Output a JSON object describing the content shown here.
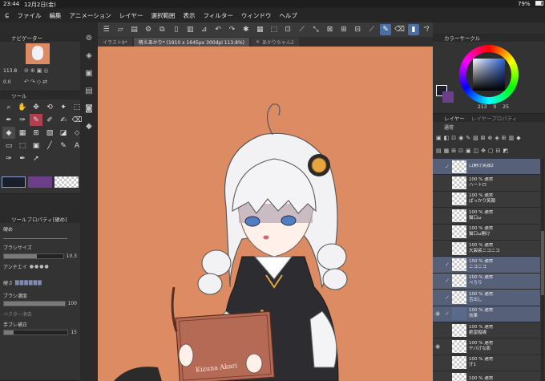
{
  "status": {
    "time": "23:44",
    "date": "12月2日(金)",
    "battery": "79%"
  },
  "menu": [
    "ファイル",
    "編集",
    "アニメーション",
    "レイヤー",
    "選択範囲",
    "表示",
    "フィルター",
    "ウィンドウ",
    "ヘルプ"
  ],
  "tabs": [
    {
      "label": "イラスト8*"
    },
    {
      "label": "萌えあかり* (1910 x 1645px 300dpi 113.8%)"
    },
    {
      "label": "あかりちゃん2"
    }
  ],
  "navigator": {
    "title": "ナビゲーター",
    "zoom": "113.8",
    "angle": "0.0"
  },
  "tool_panel": {
    "title": "ツール"
  },
  "tool_property": {
    "title": "ツールプロパティ[硬め]",
    "brush_name": "硬め",
    "brush_size_label": "ブラシサイズ",
    "brush_size_value": "10.3",
    "antialias_label": "アンチエイ",
    "hardness_label": "硬さ",
    "density_label": "ブラシ濃度",
    "density_value": "100",
    "vector_label": "ベクター消去",
    "stabilization_label": "手ブレ補正",
    "stabilization_value": "15"
  },
  "color": {
    "title": "カラーサークル",
    "readout": [
      "213",
      "0",
      "25"
    ],
    "main_color": "#1b1e2b",
    "sub_color": "#6b3f8a",
    "hue_indicator": "#2a5fd6"
  },
  "layer_panel": {
    "title": "レイヤー",
    "tab2": "レイヤープロパティ",
    "blend_mode": "通常",
    "layers": [
      {
        "line1": "口開け笑顔2",
        "line2": "",
        "selected": true,
        "checked": true,
        "eye": false,
        "folder": false
      },
      {
        "line1": "100 % 通常",
        "line2": "ハートロ",
        "selected": false,
        "checked": false,
        "eye": false,
        "folder": false
      },
      {
        "line1": "100 % 通常",
        "line2": "ぱっかり笑顔",
        "selected": false,
        "checked": false,
        "eye": false,
        "folder": false
      },
      {
        "line1": "100 % 通常",
        "line2": "猫口ω",
        "selected": false,
        "checked": false,
        "eye": false,
        "folder": false
      },
      {
        "line1": "100 % 通常",
        "line2": "猫口ω開け",
        "selected": false,
        "checked": false,
        "eye": false,
        "folder": false
      },
      {
        "line1": "100 % 通常",
        "line2": "大袈裟ニコニコ",
        "selected": false,
        "checked": false,
        "eye": false,
        "folder": false
      },
      {
        "line1": "100 % 通常",
        "line2": "ニコニコ",
        "selected": true,
        "checked": true,
        "eye": false,
        "folder": false
      },
      {
        "line1": "100 % 通常",
        "line2": "べろり",
        "selected": true,
        "checked": true,
        "eye": false,
        "folder": false
      },
      {
        "line1": "100 % 通常",
        "line2": "舌出し",
        "selected": true,
        "checked": true,
        "eye": false,
        "folder": false
      },
      {
        "line1": "100 % 通常",
        "line2": "効果",
        "selected": true,
        "checked": true,
        "eye": true,
        "folder": true
      },
      {
        "line1": "100 % 通常",
        "line2": "絶望縦線",
        "selected": false,
        "checked": false,
        "eye": false,
        "folder": false
      },
      {
        "line1": "100 % 通常",
        "line2": "ヤバげな影",
        "selected": false,
        "checked": false,
        "eye": true,
        "folder": false
      },
      {
        "line1": "100 % 通常",
        "line2": "汗1",
        "selected": false,
        "checked": false,
        "eye": false,
        "folder": false
      },
      {
        "line1": "100 % 通常",
        "line2": "",
        "selected": false,
        "checked": false,
        "eye": false,
        "folder": false
      }
    ]
  },
  "signature": "Kizuna Akari",
  "icons": {
    "left_sidebar": [
      "magnify-icon",
      "fill-icon",
      "layer-icon",
      "material-icon",
      "bucket-icon"
    ]
  }
}
